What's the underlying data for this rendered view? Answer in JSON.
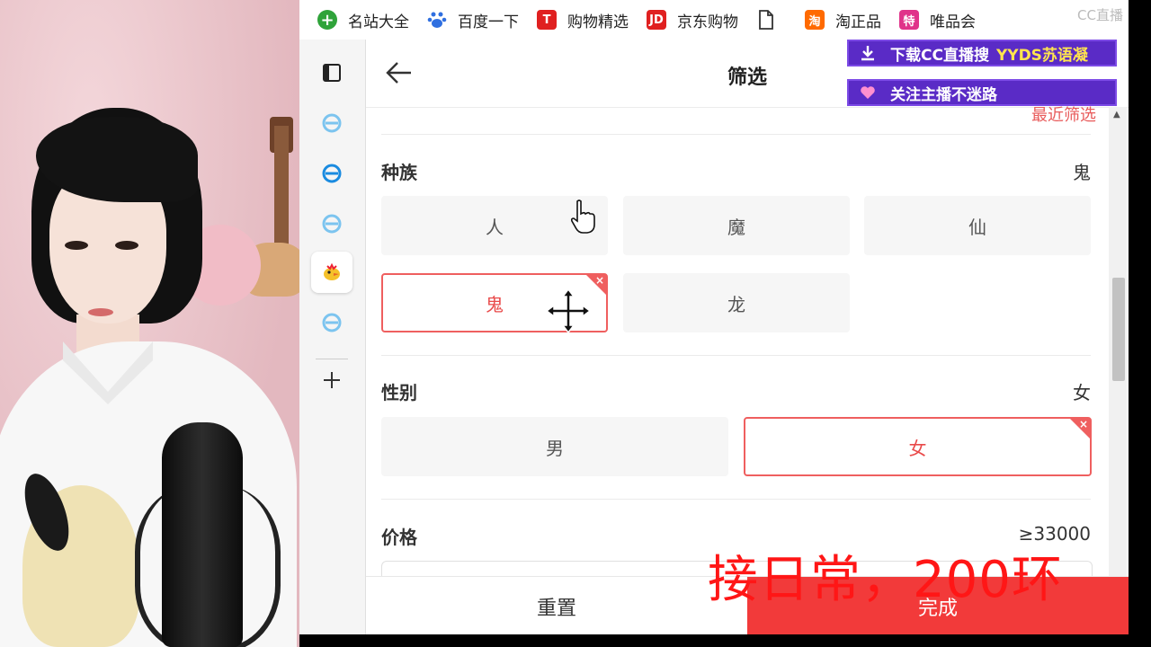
{
  "bookmarks": [
    {
      "label": "名站大全",
      "icon": "globe-plus-icon",
      "color": "#2fa33a"
    },
    {
      "label": "百度一下",
      "icon": "baidu-paw-icon",
      "color": "#2f6fe0"
    },
    {
      "label": "购物精选",
      "icon": "tmall-t-icon",
      "color": "#e02020",
      "glyph": "T"
    },
    {
      "label": "京东购物",
      "icon": "jd-icon",
      "color": "#e02020",
      "glyph": "JD"
    },
    {
      "label": "",
      "icon": "file-icon",
      "color": "#333333"
    },
    {
      "label": "淘正品",
      "icon": "taobao-icon",
      "color": "#ff6a00",
      "glyph": "淘"
    },
    {
      "label": "唯品会",
      "icon": "vip-icon",
      "color": "#e0338a",
      "glyph": "特"
    }
  ],
  "sidebar": {
    "items": [
      {
        "name": "tabs-icon"
      },
      {
        "name": "browser-e-icon"
      },
      {
        "name": "browser-e-icon"
      },
      {
        "name": "browser-e-icon"
      },
      {
        "name": "game-chick-icon",
        "active": true
      },
      {
        "name": "browser-e-icon"
      }
    ],
    "add_icon": "plus-icon"
  },
  "panel": {
    "title": "筛选",
    "recent": "最近筛选",
    "race": {
      "label": "种族",
      "value": "鬼",
      "options": [
        {
          "label": "人",
          "selected": false
        },
        {
          "label": "魔",
          "selected": false
        },
        {
          "label": "仙",
          "selected": false
        },
        {
          "label": "鬼",
          "selected": true
        },
        {
          "label": "龙",
          "selected": false
        }
      ]
    },
    "gender": {
      "label": "性别",
      "value": "女",
      "options": [
        {
          "label": "男",
          "selected": false
        },
        {
          "label": "女",
          "selected": true
        }
      ]
    },
    "price": {
      "label": "价格",
      "value": "≥33000"
    },
    "reset": "重置",
    "done": "完成",
    "remove_mark": "×"
  },
  "overlay": {
    "promo_download": {
      "text": "下载CC直播搜",
      "highlight": "YYDS苏语凝"
    },
    "promo_follow": {
      "text": "关注主播不迷路"
    },
    "caption": "接日常，200环",
    "watermark": "CC直播"
  },
  "colors": {
    "accent": "#ef5f5f",
    "done_bg": "#f23a3a",
    "promo_bg": "#5a2bc6",
    "caption": "#ff1616"
  }
}
